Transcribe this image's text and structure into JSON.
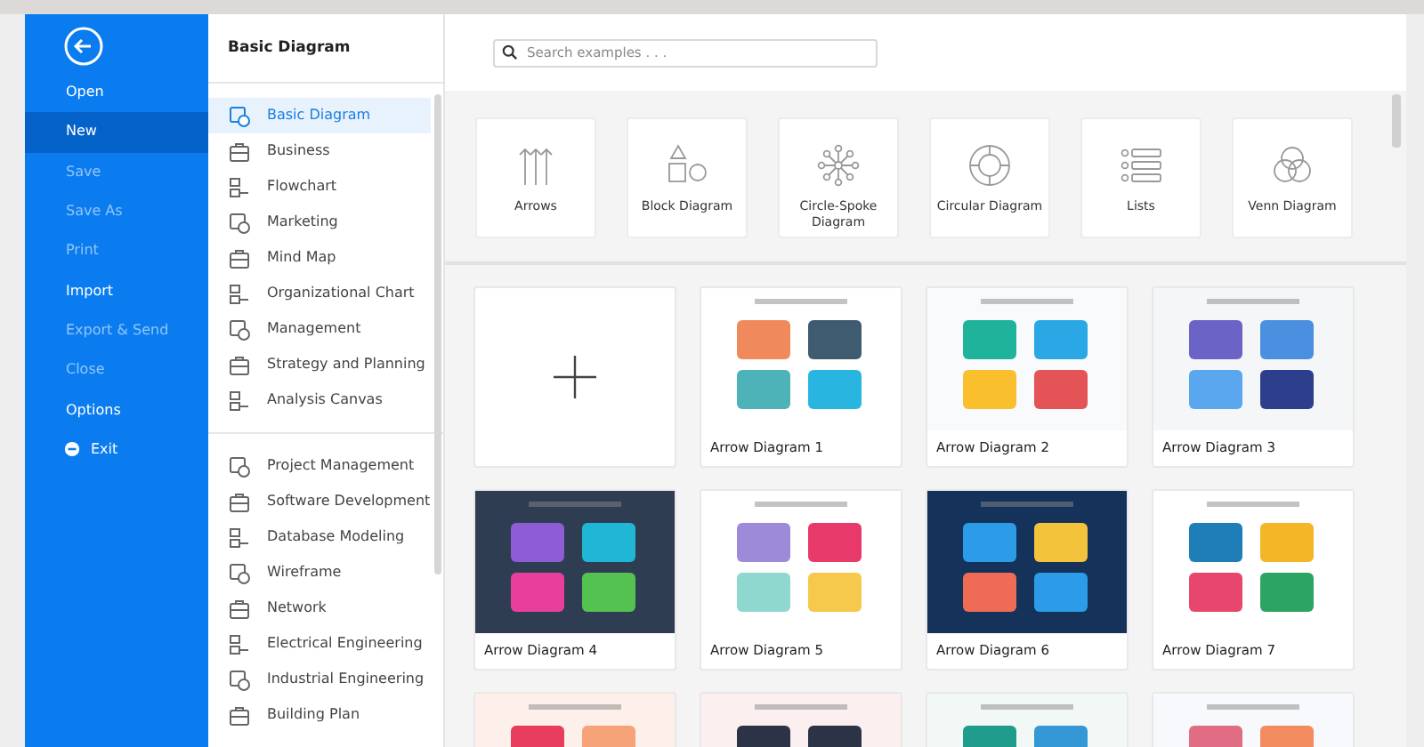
{
  "menu": [
    {
      "label": "Open",
      "kind": "item",
      "disabled": false,
      "selected": false
    },
    {
      "label": "New",
      "kind": "item",
      "disabled": false,
      "selected": true
    },
    {
      "label": "Save",
      "kind": "item",
      "disabled": true,
      "selected": false
    },
    {
      "label": "Save As",
      "kind": "item",
      "disabled": true,
      "selected": false
    },
    {
      "label": "Print",
      "kind": "item",
      "disabled": true,
      "selected": false
    },
    {
      "label": "Import",
      "kind": "item",
      "disabled": false,
      "selected": false
    },
    {
      "label": "Export & Send",
      "kind": "item",
      "disabled": true,
      "selected": false
    },
    {
      "label": "Close",
      "kind": "item",
      "disabled": true,
      "selected": false
    },
    {
      "label": "Options",
      "kind": "item",
      "disabled": false,
      "selected": false
    },
    {
      "label": "Exit",
      "kind": "exit",
      "disabled": false,
      "selected": false
    }
  ],
  "categories": {
    "title": "Basic Diagram",
    "groups": [
      [
        {
          "label": "Basic Diagram",
          "selected": true
        },
        {
          "label": "Business",
          "selected": false
        },
        {
          "label": "Flowchart",
          "selected": false
        },
        {
          "label": "Marketing",
          "selected": false
        },
        {
          "label": "Mind Map",
          "selected": false
        },
        {
          "label": "Organizational Chart",
          "selected": false
        },
        {
          "label": "Management",
          "selected": false
        },
        {
          "label": "Strategy and Planning",
          "selected": false
        },
        {
          "label": "Analysis Canvas",
          "selected": false
        }
      ],
      [
        {
          "label": "Project Management",
          "selected": false
        },
        {
          "label": "Software Development",
          "selected": false
        },
        {
          "label": "Database Modeling",
          "selected": false
        },
        {
          "label": "Wireframe",
          "selected": false
        },
        {
          "label": "Network",
          "selected": false
        },
        {
          "label": "Electrical Engineering",
          "selected": false
        },
        {
          "label": "Industrial Engineering",
          "selected": false
        },
        {
          "label": "Building Plan",
          "selected": false
        }
      ]
    ]
  },
  "search": {
    "placeholder": "Search examples . . ."
  },
  "diagram_types": [
    "Arrows",
    "Block Diagram",
    "Circle-Spoke Diagram",
    "Circular Diagram",
    "Lists",
    "Venn Diagram"
  ],
  "templates": [
    {
      "kind": "new"
    },
    {
      "kind": "template",
      "title": "Arrow Diagram 1"
    },
    {
      "kind": "template",
      "title": "Arrow Diagram 2"
    },
    {
      "kind": "template",
      "title": "Arrow Diagram 3"
    },
    {
      "kind": "template",
      "title": "Arrow Diagram 4"
    },
    {
      "kind": "template",
      "title": "Arrow Diagram 5"
    },
    {
      "kind": "template",
      "title": "Arrow Diagram 6"
    },
    {
      "kind": "template",
      "title": "Arrow Diagram 7"
    },
    {
      "kind": "template"
    },
    {
      "kind": "template"
    },
    {
      "kind": "template"
    },
    {
      "kind": "template"
    }
  ]
}
